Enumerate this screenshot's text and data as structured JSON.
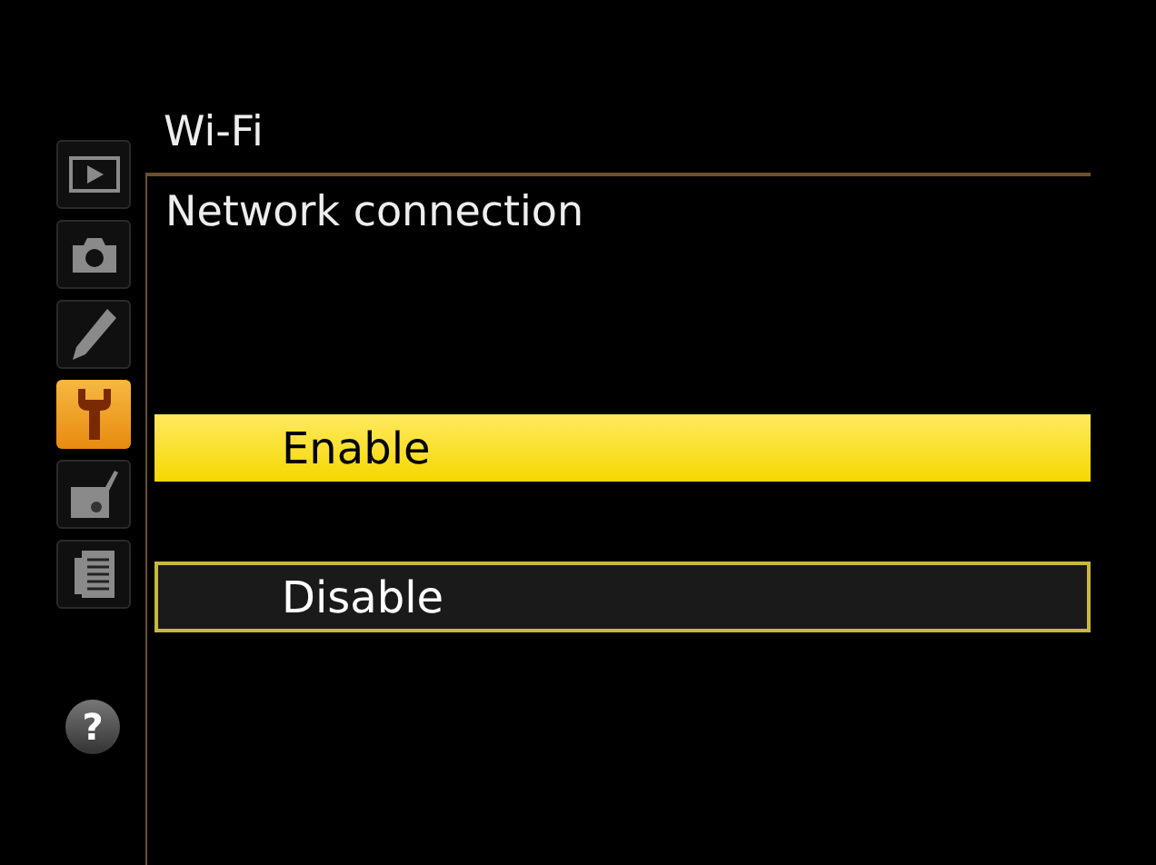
{
  "sidebar": {
    "items": [
      {
        "kind": "playback",
        "selected": false
      },
      {
        "kind": "shooting",
        "selected": false
      },
      {
        "kind": "custom",
        "selected": false
      },
      {
        "kind": "setup",
        "selected": true
      },
      {
        "kind": "retouch",
        "selected": false
      },
      {
        "kind": "recent",
        "selected": false
      }
    ],
    "help": "?"
  },
  "menu": {
    "title": "Wi-Fi",
    "subtitle": "Network connection",
    "options": [
      {
        "label": "Enable",
        "selected": true
      },
      {
        "label": "Disable",
        "selected": false
      }
    ]
  }
}
